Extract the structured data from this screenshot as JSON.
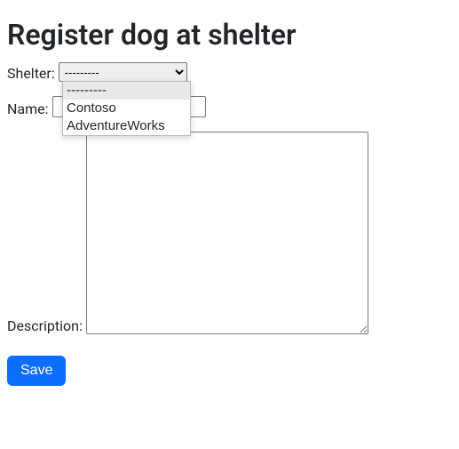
{
  "title": "Register dog at shelter",
  "fields": {
    "shelter": {
      "label": "Shelter:",
      "selected": "---------",
      "options": [
        "---------",
        "Contoso",
        "AdventureWorks"
      ]
    },
    "name": {
      "label": "Name:",
      "value": ""
    },
    "description": {
      "label": "Description:",
      "value": ""
    }
  },
  "buttons": {
    "save": "Save"
  }
}
